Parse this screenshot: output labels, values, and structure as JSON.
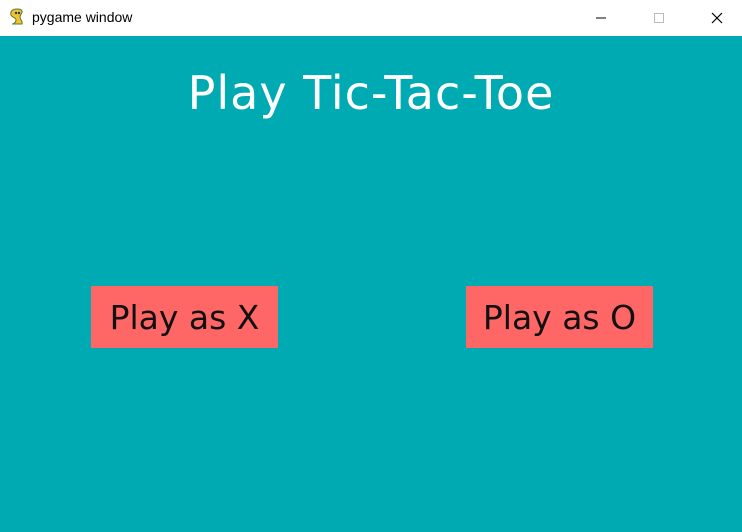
{
  "window": {
    "title": "pygame window",
    "icon": "pygame-snake-icon",
    "controls": {
      "minimize_icon": "minimize-icon",
      "maximize_icon": "maximize-icon",
      "close_icon": "close-icon"
    }
  },
  "game": {
    "heading": "Play Tic-Tac-Toe",
    "buttons": {
      "play_x": "Play as X",
      "play_o": "Play as O"
    }
  },
  "colors": {
    "background": "#00aab2",
    "button": "#ff6666",
    "heading_text": "#ffffff",
    "button_text": "#111111"
  }
}
